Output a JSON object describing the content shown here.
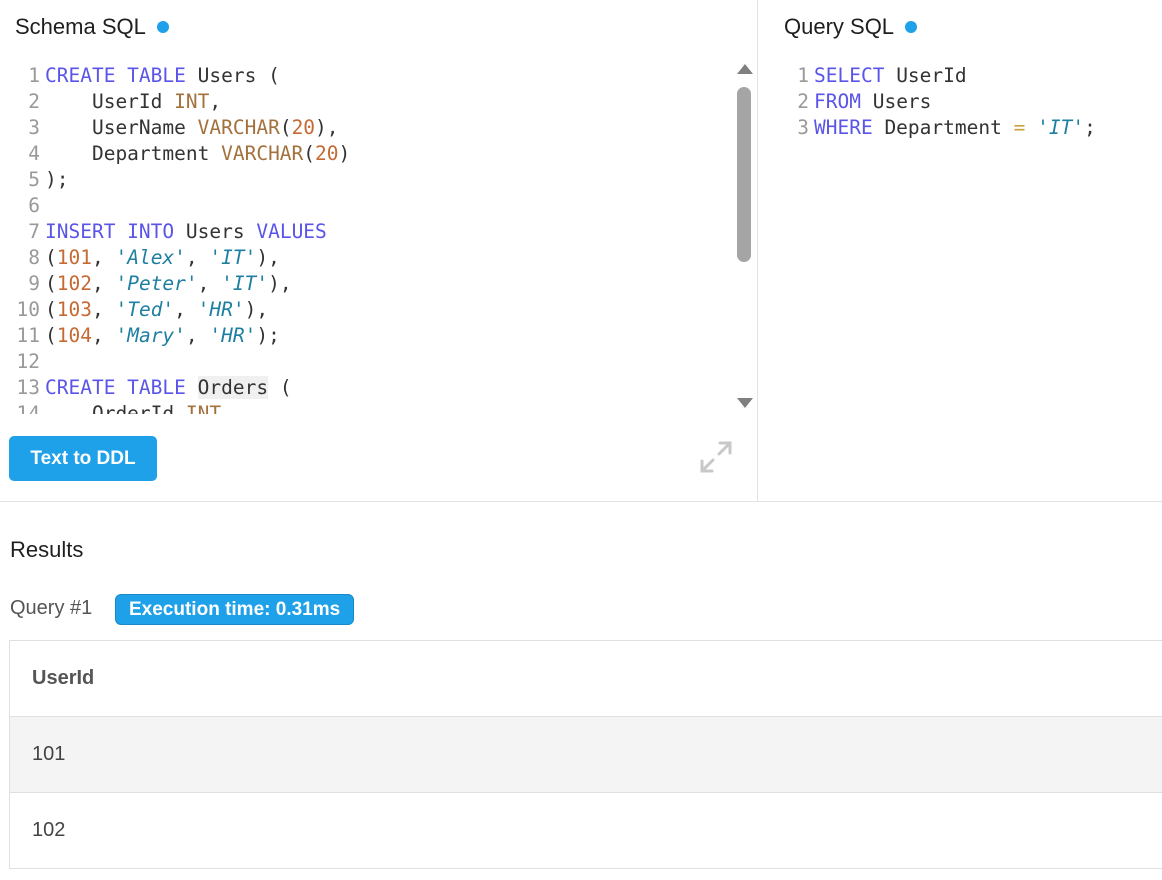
{
  "schema_panel": {
    "title": "Schema SQL",
    "button_label": "Text to DDL"
  },
  "query_panel": {
    "title": "Query SQL"
  },
  "schema_lines": [
    {
      "n": "1",
      "t": [
        [
          "kw",
          "CREATE TABLE"
        ],
        [
          "",
          "Users ("
        ]
      ]
    },
    {
      "n": "2",
      "t": [
        [
          "",
          "    UserId "
        ],
        [
          "ty",
          "INT"
        ],
        [
          "",
          ","
        ]
      ]
    },
    {
      "n": "3",
      "t": [
        [
          "",
          "    UserName "
        ],
        [
          "ty",
          "VARCHAR"
        ],
        [
          "",
          "("
        ],
        [
          "num",
          "20"
        ],
        [
          "",
          "),"
        ]
      ]
    },
    {
      "n": "4",
      "t": [
        [
          "",
          "    Department "
        ],
        [
          "ty",
          "VARCHAR"
        ],
        [
          "",
          "("
        ],
        [
          "num",
          "20"
        ],
        [
          "",
          ")"
        ]
      ]
    },
    {
      "n": "5",
      "t": [
        [
          "",
          ");"
        ]
      ]
    },
    {
      "n": "6",
      "t": []
    },
    {
      "n": "7",
      "t": [
        [
          "kw",
          "INSERT INTO"
        ],
        [
          "",
          "Users "
        ],
        [
          "kw",
          "VALUES"
        ]
      ]
    },
    {
      "n": "8",
      "t": [
        [
          "",
          "("
        ],
        [
          "num",
          "101"
        ],
        [
          "",
          ", "
        ],
        [
          "str",
          "'Alex'"
        ],
        [
          "",
          ", "
        ],
        [
          "str",
          "'IT'"
        ],
        [
          "",
          "),"
        ]
      ]
    },
    {
      "n": "9",
      "t": [
        [
          "",
          "("
        ],
        [
          "num",
          "102"
        ],
        [
          "",
          ", "
        ],
        [
          "str",
          "'Peter'"
        ],
        [
          "",
          ", "
        ],
        [
          "str",
          "'IT'"
        ],
        [
          "",
          "),"
        ]
      ]
    },
    {
      "n": "10",
      "t": [
        [
          "",
          "("
        ],
        [
          "num",
          "103"
        ],
        [
          "",
          ", "
        ],
        [
          "str",
          "'Ted'"
        ],
        [
          "",
          ", "
        ],
        [
          "str",
          "'HR'"
        ],
        [
          "",
          "),"
        ]
      ]
    },
    {
      "n": "11",
      "t": [
        [
          "",
          "("
        ],
        [
          "num",
          "104"
        ],
        [
          "",
          ", "
        ],
        [
          "str",
          "'Mary'"
        ],
        [
          "",
          ", "
        ],
        [
          "str",
          "'HR'"
        ],
        [
          "",
          ");"
        ]
      ]
    },
    {
      "n": "12",
      "t": []
    },
    {
      "n": "13",
      "t": [
        [
          "kw",
          "CREATE TABLE"
        ],
        [
          "hl",
          "Orders"
        ],
        [
          "",
          " ("
        ]
      ]
    },
    {
      "n": "14",
      "t": [
        [
          "",
          "    OrderId "
        ],
        [
          "ty",
          "INT"
        ]
      ]
    }
  ],
  "query_lines": [
    {
      "n": "1",
      "t": [
        [
          "kw",
          "SELECT"
        ],
        [
          "",
          " UserId"
        ]
      ]
    },
    {
      "n": "2",
      "t": [
        [
          "kw",
          "FROM"
        ],
        [
          "",
          " Users"
        ]
      ]
    },
    {
      "n": "3",
      "t": [
        [
          "kw",
          "WHERE"
        ],
        [
          "",
          " Department "
        ],
        [
          "op",
          "="
        ],
        [
          "",
          " "
        ],
        [
          "str",
          "'IT'"
        ],
        [
          "",
          ";"
        ]
      ]
    }
  ],
  "results": {
    "title": "Results",
    "query_label": "Query #1",
    "execution_time": "Execution time: 0.31ms",
    "columns": [
      "UserId"
    ],
    "rows": [
      [
        "101"
      ],
      [
        "102"
      ]
    ]
  },
  "colors": {
    "accent": "#1ea1e8",
    "keyword": "#5a55e8",
    "type": "#a3713c",
    "number": "#c56a33",
    "string": "#1e7fa0"
  },
  "icons": {
    "expand": "expand-icon",
    "status_dot": "status-dot-icon"
  }
}
